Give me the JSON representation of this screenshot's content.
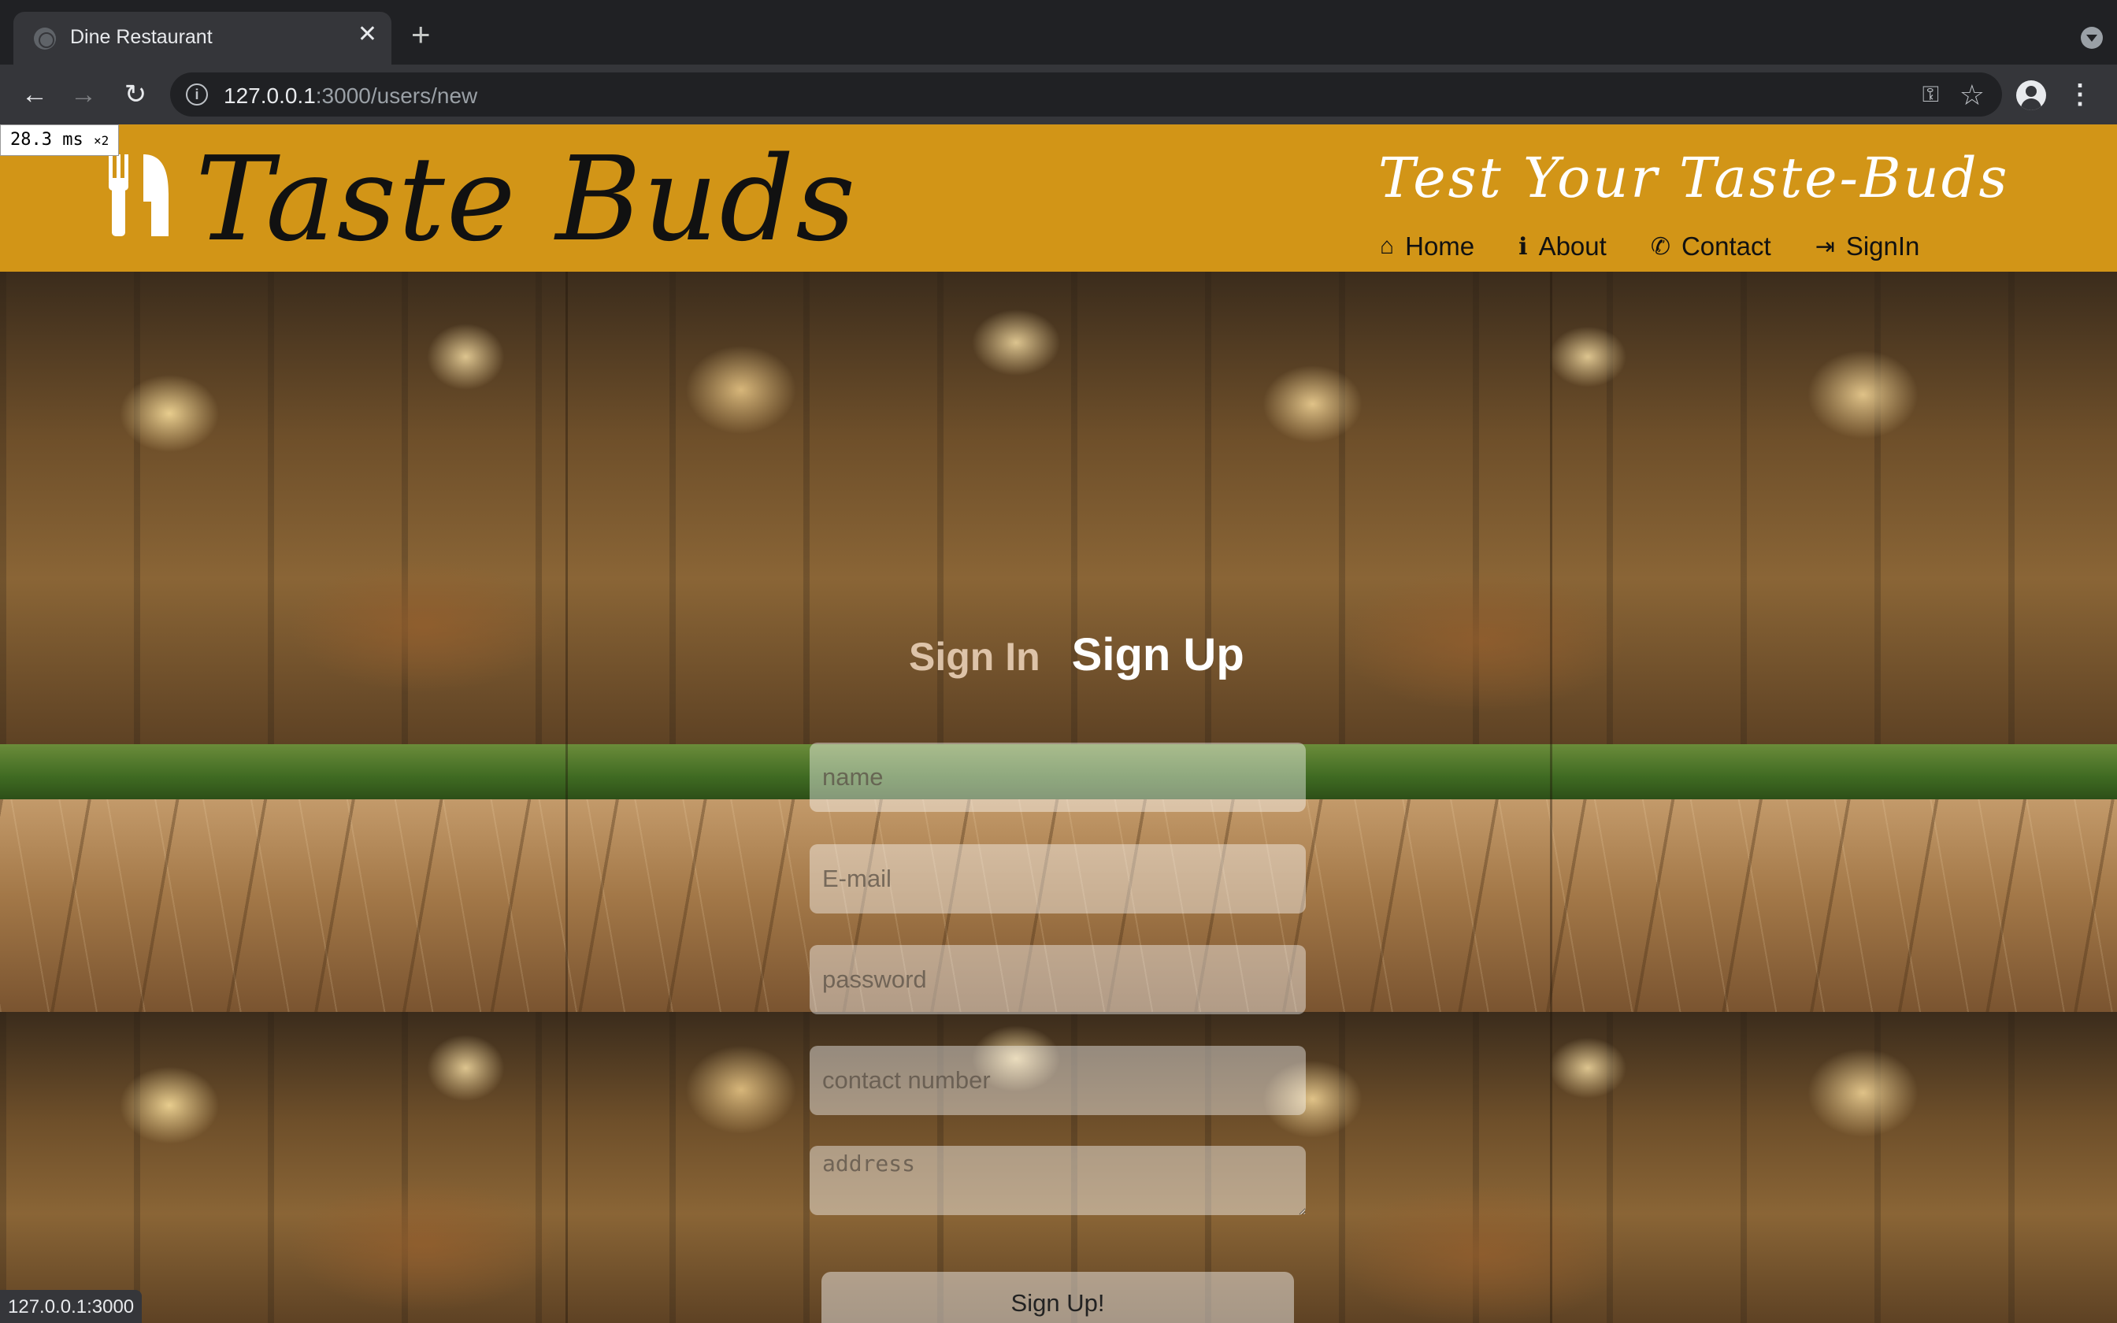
{
  "browser": {
    "tab_title": "Dine Restaurant",
    "tab_close": "✕",
    "new_tab": "+",
    "url_host": "127.0.0.1",
    "url_rest": ":3000/users/new",
    "status_url": "127.0.0.1:3000"
  },
  "perf": {
    "time": "28.3 ms",
    "scale": "×2"
  },
  "site": {
    "logo_text": "Taste Buds",
    "tagline": "Test Your Taste-Buds",
    "nav": [
      {
        "label": "Home",
        "icon": "home-icon"
      },
      {
        "label": "About",
        "icon": "info-icon"
      },
      {
        "label": "Contact",
        "icon": "phone-icon"
      },
      {
        "label": "SignIn",
        "icon": "sign-in-icon"
      }
    ],
    "colors": {
      "header": "#d29517",
      "tagline": "#ffffff"
    }
  },
  "form": {
    "tab_signin": "Sign In",
    "tab_signup": "Sign Up",
    "name_placeholder": "name",
    "email_placeholder": "E-mail",
    "password_placeholder": "password",
    "contact_placeholder": "contact number",
    "address_placeholder": "address",
    "submit_label": "Sign Up!"
  }
}
